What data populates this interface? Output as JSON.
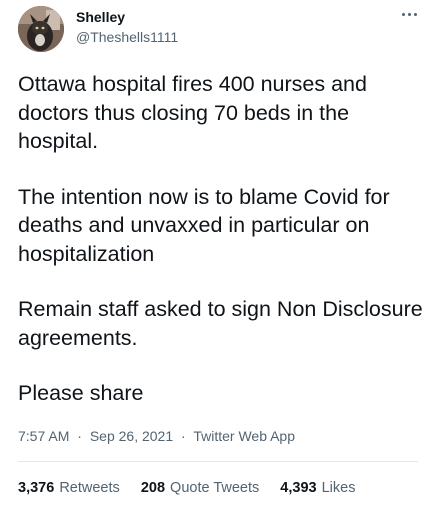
{
  "user": {
    "name": "Shelley",
    "handle": "@Theshells1111"
  },
  "icons": {
    "more": "more-horizontal-icon"
  },
  "tweet": {
    "paragraphs": [
      "Ottawa hospital fires 400 nurses and doctors thus closing 70 beds in the hospital.",
      "The intention now is to blame Covid for deaths and unvaxxed in particular on hospitalization",
      "Remain staff asked to sign Non Disclosure agreements.",
      "Please share"
    ],
    "time": "7:57 AM",
    "date": "Sep 26, 2021",
    "source": "Twitter Web App",
    "separator": "·"
  },
  "stats": {
    "retweets_count": "3,376",
    "retweets_label": "Retweets",
    "quotes_count": "208",
    "quotes_label": "Quote Tweets",
    "likes_count": "4,393",
    "likes_label": "Likes"
  },
  "colors": {
    "text_primary": "#0f1419",
    "text_secondary": "#536471",
    "divider": "#e4e8eb"
  }
}
